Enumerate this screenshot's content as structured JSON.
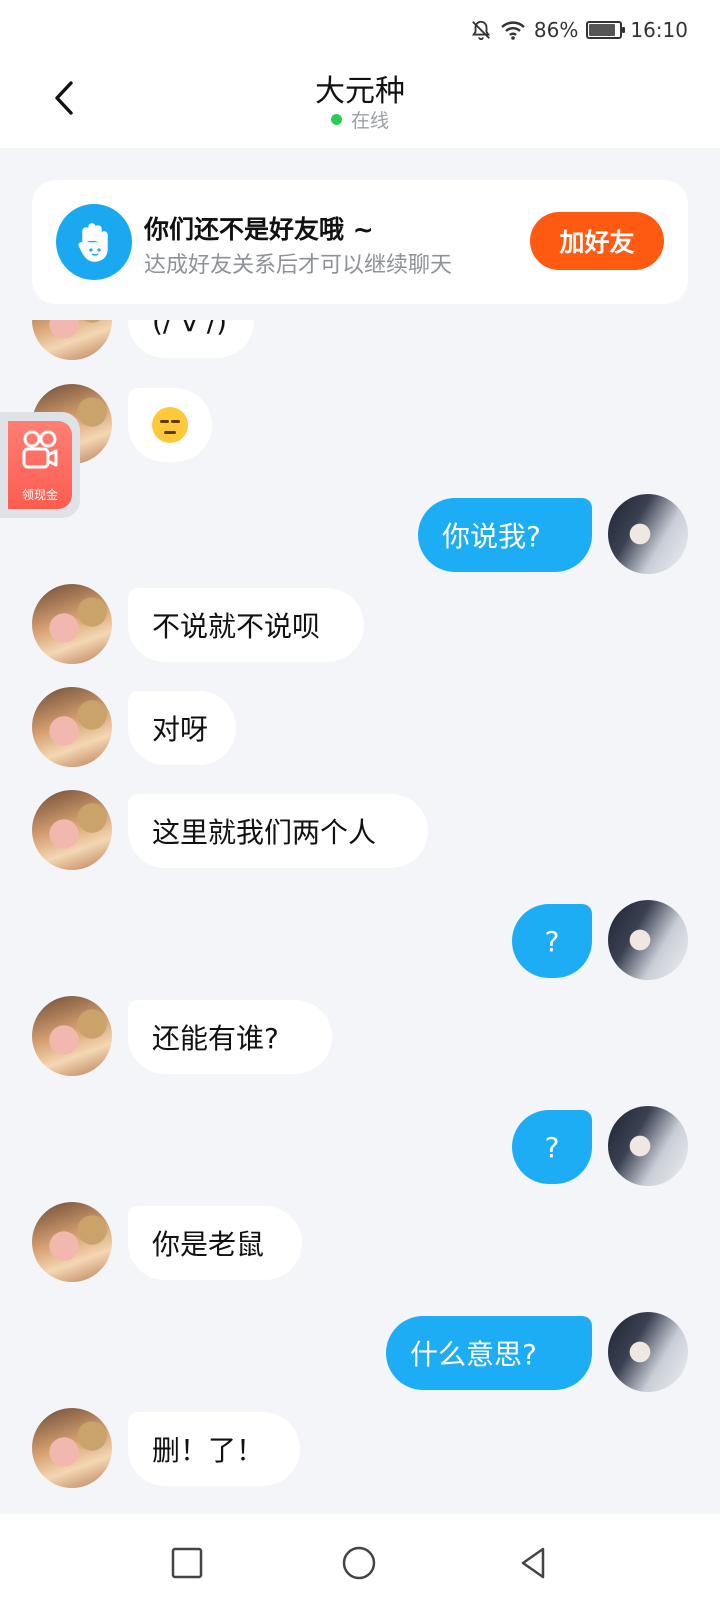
{
  "status_bar": {
    "battery_percent": "86%",
    "time": "16:10",
    "icons": [
      "bell-off-icon",
      "wifi-icon",
      "battery-charging-icon"
    ]
  },
  "header": {
    "title": "大元种",
    "status": "在线",
    "status_color": "#2ecc57"
  },
  "friend_prompt": {
    "title": "你们还不是好友哦 ~",
    "subtitle": "达成好友关系后才可以继续聊天",
    "button": "加好友",
    "button_color": "#ff5a12",
    "icon": "hand-wave-icon"
  },
  "floating_widget": {
    "label": "领现金",
    "icon": "kuaishou-icon"
  },
  "messages": [
    {
      "from": "them",
      "text": "(/ v /)"
    },
    {
      "from": "them",
      "text": "",
      "emoji": "unamused-face"
    },
    {
      "from": "me",
      "text": "你说我?"
    },
    {
      "from": "them",
      "text": "不说就不说呗"
    },
    {
      "from": "them",
      "text": "对呀"
    },
    {
      "from": "them",
      "text": "这里就我们两个人"
    },
    {
      "from": "me",
      "text": "?"
    },
    {
      "from": "them",
      "text": "还能有谁?"
    },
    {
      "from": "me",
      "text": "?"
    },
    {
      "from": "them",
      "text": "你是老鼠"
    },
    {
      "from": "me",
      "text": "什么意思?"
    },
    {
      "from": "them",
      "text": "删！了！"
    }
  ],
  "colors": {
    "my_bubble": "#1cadf5",
    "their_bubble": "#ffffff",
    "background": "#f3f5f8"
  },
  "nav_bar": {
    "buttons": [
      "recents-square-icon",
      "home-circle-icon",
      "back-triangle-icon"
    ]
  }
}
